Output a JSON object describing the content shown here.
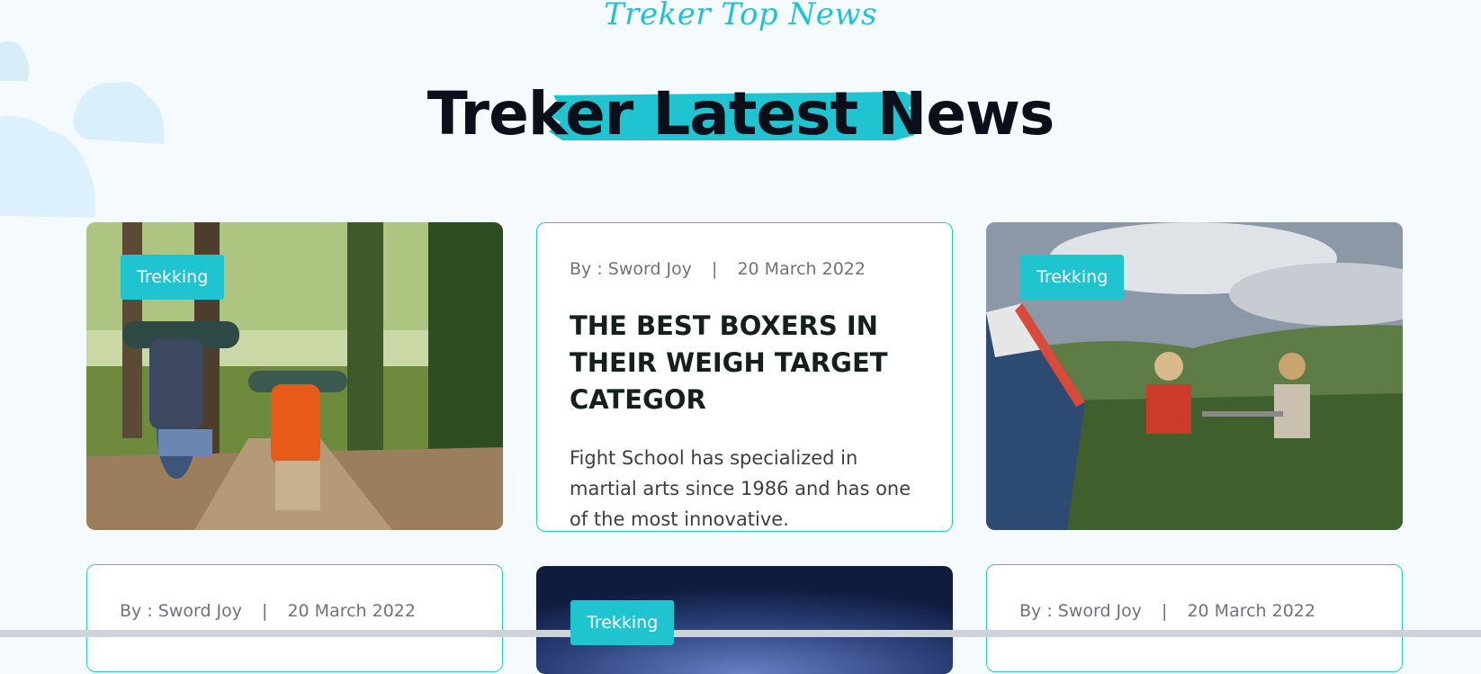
{
  "section": {
    "eyebrow": "Treker Top News",
    "title": "Treker Latest News"
  },
  "cards": [
    {
      "kind": "image",
      "badge": "Trekking",
      "image": "hikers-forest-trail"
    },
    {
      "kind": "text",
      "author": "By : Sword Joy",
      "separator": "|",
      "date": "20 March 2022",
      "headline": "THE BEST BOXERS IN THEIR WEIGH TARGET CATEGOR",
      "description": "Fight School has specialized in martial arts since 1986 and has one of the most innovative."
    },
    {
      "kind": "image",
      "badge": "Trekking",
      "image": "campers-tent-mountains"
    },
    {
      "kind": "text",
      "author": "By : Sword Joy",
      "separator": "|",
      "date": "20 March 2022"
    },
    {
      "kind": "image",
      "badge": "Trekking",
      "image": "night-sky"
    },
    {
      "kind": "text",
      "author": "By : Sword Joy",
      "separator": "|",
      "date": "20 March 2022"
    }
  ],
  "colors": {
    "accent": "#1fc4d0",
    "border": "#29c6cf",
    "heading": "#0b0f1a",
    "background": "#f5faff"
  }
}
